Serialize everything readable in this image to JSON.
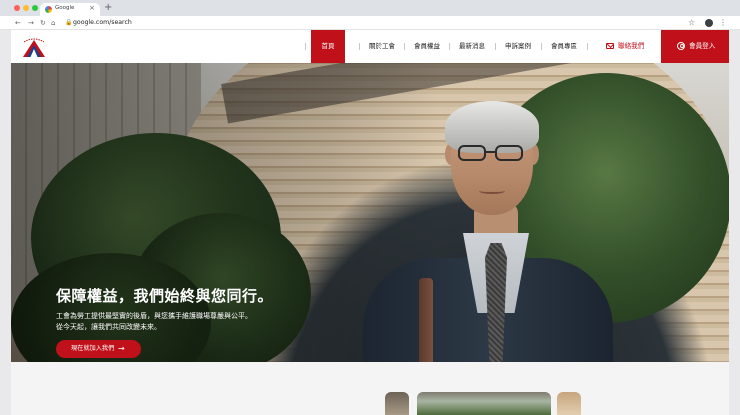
{
  "browser": {
    "tab_title": "Google",
    "url": "google.com/search",
    "new_tab": "+",
    "close": "×",
    "back": "←",
    "forward": "→",
    "reload": "↻",
    "home": "⌂",
    "star": "☆",
    "menu": "⋮",
    "lock": "🔒"
  },
  "header": {
    "nav": [
      "首頁",
      "關於工會",
      "會員權益",
      "最新消息",
      "申訴案例",
      "會員專區"
    ],
    "active_index": 0,
    "contact_label": "聯絡我們",
    "login_label": "會員登入",
    "brand_color": "#c0101a"
  },
  "hero": {
    "title": "保障權益，我們始終與您同行。",
    "desc_line1": "工會為勞工提供最堅實的後盾，與您攜手維護職場尊嚴與公平。",
    "desc_line2": "從今天起，讓我們共同改變未來。",
    "cta_label": "現在就加入我們",
    "cta_arrow": "→"
  }
}
